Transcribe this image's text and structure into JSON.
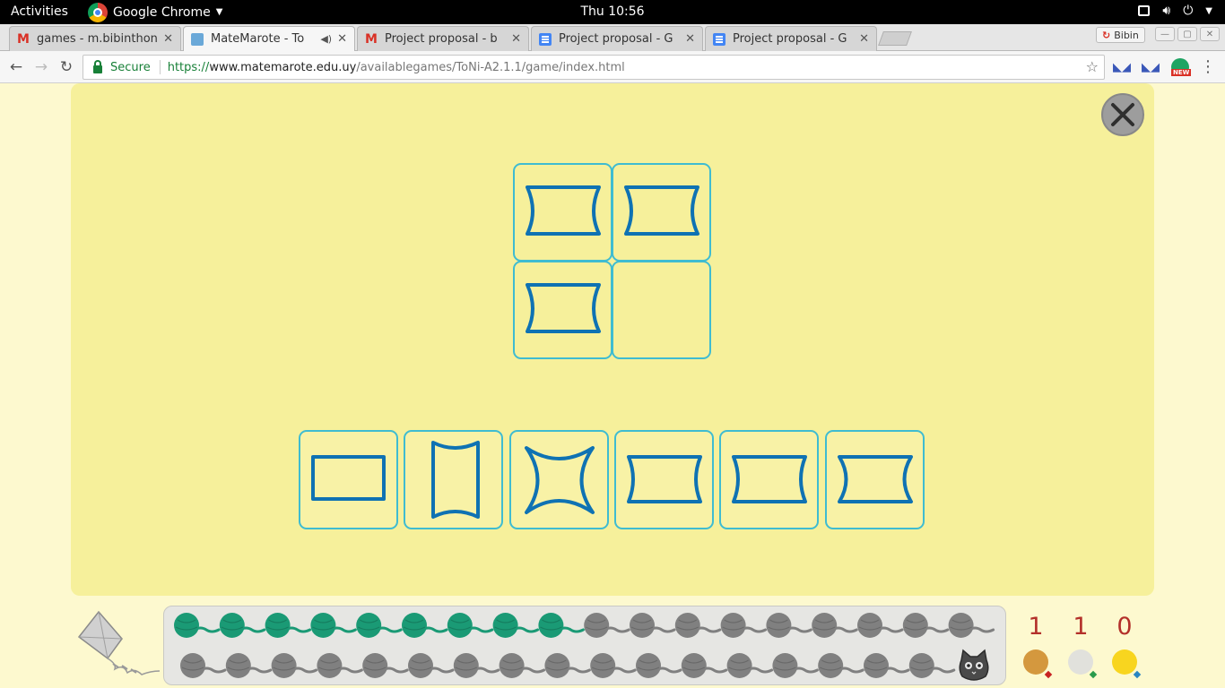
{
  "topbar": {
    "activities": "Activities",
    "app_name": "Google Chrome",
    "clock": "Thu 10:56"
  },
  "tabs": [
    {
      "title": "games - m.bibinthon",
      "favicon": "gmail-icon",
      "active": false
    },
    {
      "title": "MateMarote - To",
      "favicon": "matemarote-icon",
      "active": true,
      "audio": true
    },
    {
      "title": "Project proposal - b",
      "favicon": "gmail-icon",
      "active": false
    },
    {
      "title": "Project proposal - G",
      "favicon": "docs-icon",
      "active": false
    },
    {
      "title": "Project proposal - G",
      "favicon": "docs-icon",
      "active": false
    }
  ],
  "profile": {
    "name": "Bibin"
  },
  "omnibox": {
    "secure_label": "Secure",
    "scheme": "https://",
    "host": "www.matemarote.edu.uy",
    "path": "/availablegames/ToNi-A2.1.1/game/index.html"
  },
  "game": {
    "grid": [
      "concave-sides-rectangle",
      "concave-sides-rectangle",
      "concave-sides-rectangle",
      "empty"
    ],
    "options": [
      "rectangle",
      "concave-top-bottom-rectangle",
      "concave-star",
      "concave-sides-rectangle",
      "concave-sides-rectangle",
      "concave-sides-rectangle"
    ],
    "progress": {
      "completed": 9,
      "total": 36
    },
    "scores": [
      {
        "value": "1",
        "medal": "bronze"
      },
      {
        "value": "1",
        "medal": "silver"
      },
      {
        "value": "0",
        "medal": "gold"
      }
    ]
  },
  "colors": {
    "board": "#f6f09b",
    "page": "#fdf9cf",
    "cell_border": "#3fbcd1",
    "shape_stroke": "#0f72b3",
    "yarn_done": "#1a9a75",
    "yarn_pending": "#808080",
    "score_text": "#b3302a"
  }
}
